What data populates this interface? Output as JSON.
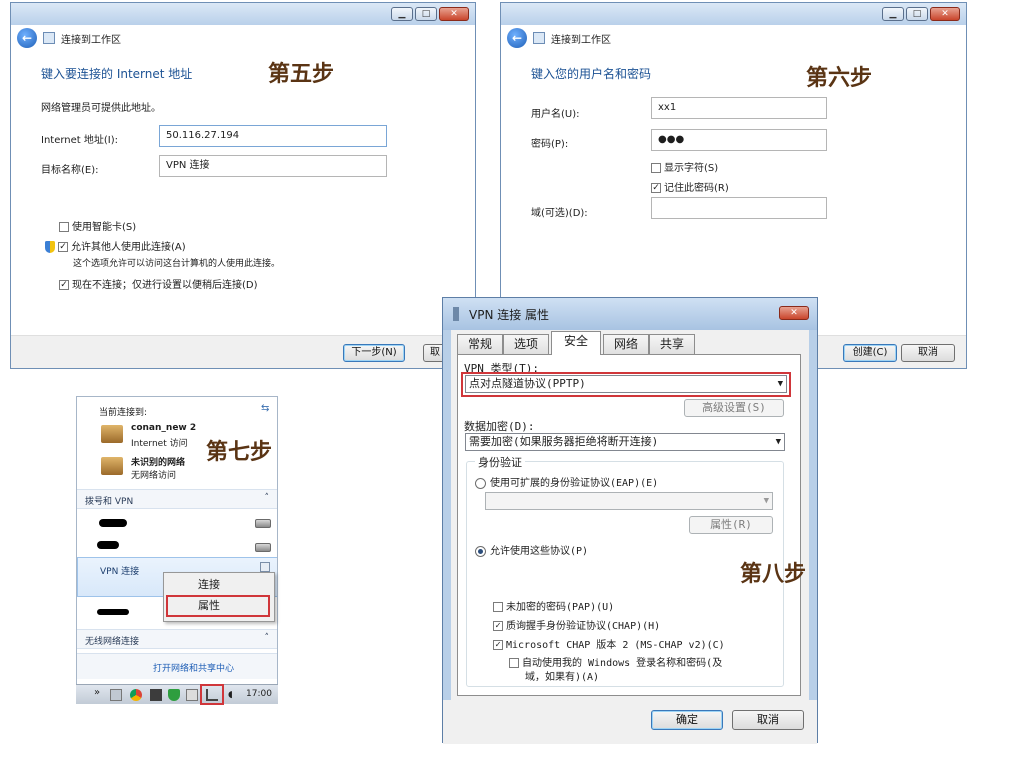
{
  "step5": {
    "step_label": "第五步",
    "header": "连接到工作区",
    "title": "键入要连接的 Internet 地址",
    "note": "网络管理员可提供此地址。",
    "internet_label": "Internet 地址(I):",
    "internet_value": "50.116.27.194",
    "dest_label": "目标名称(E):",
    "dest_value": "VPN 连接",
    "smartcard": "使用智能卡(S)",
    "allow_others": "允许其他人使用此连接(A)",
    "allow_note": "这个选项允许可以访问这台计算机的人使用此连接。",
    "dont_connect": "现在不连接；仅进行设置以便稍后连接(D)",
    "next_btn": "下一步(N)",
    "cancel_btn": "取"
  },
  "step6": {
    "step_label": "第六步",
    "header": "连接到工作区",
    "title": "键入您的用户名和密码",
    "user_label": "用户名(U):",
    "user_value": "xx1",
    "pass_label": "密码(P):",
    "pass_value": "●●●",
    "show_chars": "显示字符(S)",
    "remember": "记住此密码(R)",
    "domain_label": "域(可选)(D):",
    "create_btn": "创建(C)",
    "cancel_btn": "取消"
  },
  "step7": {
    "step_label": "第七步",
    "current_label": "当前连接到:",
    "networks": [
      {
        "name": "conan_new  2",
        "status": "Internet 访问"
      },
      {
        "name": "未识别的网络",
        "status": "无网络访问"
      }
    ],
    "dialup_section": "拨号和 VPN",
    "vpn_item": "VPN 连接",
    "wireless_section": "无线网络连接",
    "open_center": "打开网络和共享中心",
    "context_menu": [
      "连接",
      "属性"
    ],
    "clock": "17:00"
  },
  "step8": {
    "step_label": "第八步",
    "dialog_title": "VPN 连接 属性",
    "tabs": [
      "常规",
      "选项",
      "安全",
      "网络",
      "共享"
    ],
    "vpn_type_label": "VPN 类型(T):",
    "vpn_type_value": "点对点隧道协议(PPTP)",
    "advanced_btn": "高级设置(S)",
    "encryption_label": "数据加密(D):",
    "encryption_value": "需要加密(如果服务器拒绝将断开连接)",
    "auth_group": "身份验证",
    "eap_radio": "使用可扩展的身份验证协议(EAP)(E)",
    "eap_props_btn": "属性(R)",
    "allow_protocols": "允许使用这些协议(P)",
    "pap": "未加密的密码(PAP)(U)",
    "chap": "质询握手身份验证协议(CHAP)(H)",
    "mschap": "Microsoft CHAP 版本 2 (MS-CHAP v2)(C)",
    "auto_logon_1": "自动使用我的 Windows 登录名称和密码(及",
    "auto_logon_2": "域，如果有)(A)",
    "ok_btn": "确定",
    "cancel_btn": "取消"
  }
}
